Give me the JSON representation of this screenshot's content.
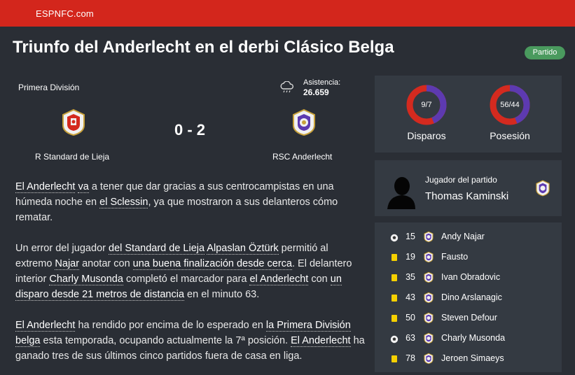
{
  "header": {
    "brand": "ESPNFC.com"
  },
  "article": {
    "title": "Triunfo del Anderlecht en el derbi Clásico Belga",
    "status": "Partido"
  },
  "match": {
    "competition": "Primera División",
    "attendance_label": "Asistencia:",
    "attendance_value": "26.659",
    "score": "0 - 2",
    "home_team": "R Standard de Lieja",
    "away_team": "RSC Anderlecht",
    "weather_icon": "cloud-rain-icon"
  },
  "paragraphs": [
    {
      "segments": [
        {
          "t": "El Anderlecht",
          "link": true
        },
        {
          "t": " "
        },
        {
          "t": "va",
          "link": true
        },
        {
          "t": " a tener que dar gracias a sus centrocampistas en una húmeda noche en "
        },
        {
          "t": "el Sclessin",
          "link": true
        },
        {
          "t": ", ya que mostraron a sus delanteros cómo rematar."
        }
      ]
    },
    {
      "segments": [
        {
          "t": "Un error del jugador "
        },
        {
          "t": "del Standard de Lieja",
          "link": true
        },
        {
          "t": " "
        },
        {
          "t": "Alpaslan Öztürk",
          "link": true
        },
        {
          "t": " permitió al extremo "
        },
        {
          "t": "Najar",
          "link": true
        },
        {
          "t": " anotar con "
        },
        {
          "t": "una buena finalización desde cerca",
          "link": true
        },
        {
          "t": ". El delantero interior "
        },
        {
          "t": "Charly Musonda",
          "link": true
        },
        {
          "t": " completó el marcador para "
        },
        {
          "t": "el Anderlecht",
          "link": true
        },
        {
          "t": " con "
        },
        {
          "t": "un disparo desde 21 metros de distancia",
          "link": true
        },
        {
          "t": " en el minuto 63."
        }
      ]
    },
    {
      "segments": [
        {
          "t": "El Anderlecht",
          "link": true
        },
        {
          "t": " ha rendido por encima de lo esperado en "
        },
        {
          "t": "la Primera División belga",
          "link": true
        },
        {
          "t": " esta temporada, ocupando actualmente la 7ª posición. "
        },
        {
          "t": "El Anderlecht",
          "link": true
        },
        {
          "t": " ha ganado tres de sus últimos cinco partidos fuera de casa en liga."
        }
      ]
    }
  ],
  "stats": [
    {
      "label": "Disparos",
      "value": "9/7",
      "home": 9,
      "away": 7
    },
    {
      "label": "Posesión",
      "value": "56/44",
      "home": 56,
      "away": 44
    }
  ],
  "motm": {
    "title": "Jugador del partido",
    "name": "Thomas Kaminski"
  },
  "events": [
    {
      "type": "goal",
      "icon": "ball-icon",
      "minute": "15",
      "player": "Andy Najar"
    },
    {
      "type": "yellow",
      "icon": "yellow-card-icon",
      "minute": "19",
      "player": "Fausto"
    },
    {
      "type": "yellow",
      "icon": "yellow-card-icon",
      "minute": "35",
      "player": "Ivan Obradovic"
    },
    {
      "type": "yellow",
      "icon": "yellow-card-icon",
      "minute": "43",
      "player": "Dino Arslanagic"
    },
    {
      "type": "yellow",
      "icon": "yellow-card-icon",
      "minute": "50",
      "player": "Steven Defour"
    },
    {
      "type": "goal",
      "icon": "ball-icon",
      "minute": "63",
      "player": "Charly Musonda"
    },
    {
      "type": "yellow",
      "icon": "yellow-card-icon",
      "minute": "78",
      "player": "Jeroen Simaeys"
    }
  ],
  "colors": {
    "brand_red": "#d3261c",
    "background": "#2a2e35",
    "panel": "#343a42",
    "status_green": "#4a9a5e",
    "ring_home": "#d42a1f",
    "ring_away": "#5d3ab0",
    "yellow_card": "#f5d000"
  }
}
